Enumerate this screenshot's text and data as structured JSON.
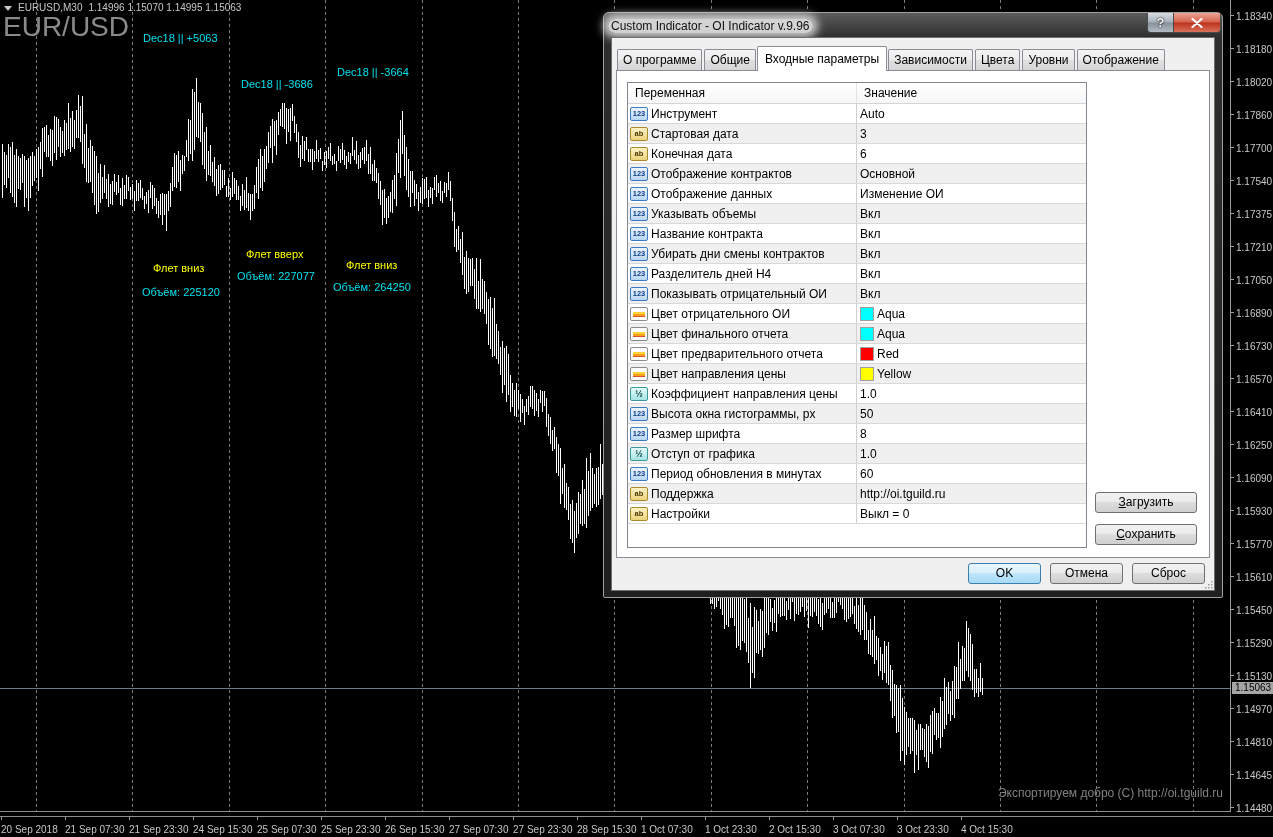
{
  "chart": {
    "title": "EURUSD,M30",
    "quotes": "1.14996 1.15070 1.14995 1.15063",
    "symbol_label": "EUR/USD",
    "labels": [
      {
        "kind": "oi",
        "text": "Dec18 || +5063"
      },
      {
        "kind": "oi",
        "text": "Dec18 || -3686"
      },
      {
        "kind": "oi",
        "text": "Dec18 || -3664"
      },
      {
        "kind": "trend",
        "text": "Флет вниз"
      },
      {
        "kind": "volume",
        "text": "Объём: 225120"
      },
      {
        "kind": "trend",
        "text": "Флет вверх"
      },
      {
        "kind": "volume",
        "text": "Объём: 227077"
      },
      {
        "kind": "trend",
        "text": "Флет вниз"
      },
      {
        "kind": "volume",
        "text": "Объём: 264250"
      }
    ],
    "footer": "Экспортируем добро (C) http://oi.tguild.ru",
    "price_axis": [
      "1.18340",
      "1.18180",
      "1.18020",
      "1.17860",
      "1.17700",
      "1.17540",
      "1.17375",
      "1.17210",
      "1.17050",
      "1.16890",
      "1.16730",
      "1.16570",
      "1.16410",
      "1.16250",
      "1.16090",
      "1.15930",
      "1.15770",
      "1.15610",
      "1.15450",
      "1.15290",
      "1.15130",
      "1.14970",
      "1.14810",
      "1.14645",
      "1.14480"
    ],
    "current_price": "1.15063",
    "time_axis": [
      "20 Sep 2018",
      "21 Sep 07:30",
      "21 Sep 23:30",
      "24 Sep 15:30",
      "25 Sep 07:30",
      "25 Sep 23:30",
      "26 Sep 15:30",
      "27 Sep 07:30",
      "27 Sep 23:30",
      "28 Sep 15:30",
      "1 Oct 07:30",
      "1 Oct 23:30",
      "2 Oct 15:30",
      "3 Oct 07:30",
      "3 Oct 23:30",
      "4 Oct 15:30"
    ]
  },
  "dialog": {
    "title": "Custom Indicator - OI Indicator v.9.96",
    "help": "?",
    "tabs": [
      {
        "label": "О программе",
        "selected": false
      },
      {
        "label": "Общие",
        "selected": false
      },
      {
        "label": "Входные параметры",
        "selected": true
      },
      {
        "label": "Зависимости",
        "selected": false
      },
      {
        "label": "Цвета",
        "selected": false
      },
      {
        "label": "Уровни",
        "selected": false
      },
      {
        "label": "Отображение",
        "selected": false
      }
    ],
    "table": {
      "columns": [
        "Переменная",
        "Значение"
      ],
      "rows": [
        {
          "kind": "int",
          "icon": "123",
          "name": "Инструмент",
          "value": "Auto"
        },
        {
          "kind": "string",
          "icon": "ab",
          "name": "Стартовая дата",
          "value": "3"
        },
        {
          "kind": "string",
          "icon": "ab",
          "name": "Конечная дата",
          "value": "6"
        },
        {
          "kind": "int",
          "icon": "123",
          "name": "Отображение контрактов",
          "value": "Основной"
        },
        {
          "kind": "int",
          "icon": "123",
          "name": "Отображение данных",
          "value": "Изменение ОИ"
        },
        {
          "kind": "int",
          "icon": "123",
          "name": "Указывать объемы",
          "value": "Вкл"
        },
        {
          "kind": "int",
          "icon": "123",
          "name": "Название контракта",
          "value": "Вкл"
        },
        {
          "kind": "int",
          "icon": "123",
          "name": "Убирать дни смены контрактов",
          "value": "Вкл"
        },
        {
          "kind": "int",
          "icon": "123",
          "name": "Разделитель дней H4",
          "value": "Вкл"
        },
        {
          "kind": "int",
          "icon": "123",
          "name": "Показывать отрицательный ОИ",
          "value": "Вкл"
        },
        {
          "kind": "color",
          "name": "Цвет отрицательного ОИ",
          "value": "Aqua",
          "color": "#00ffff"
        },
        {
          "kind": "color",
          "name": "Цвет финального отчета",
          "value": "Aqua",
          "color": "#00ffff"
        },
        {
          "kind": "color",
          "name": "Цвет предварительного отчета",
          "value": "Red",
          "color": "#ff0000"
        },
        {
          "kind": "color",
          "name": "Цвет направления цены",
          "value": "Yellow",
          "color": "#ffff00"
        },
        {
          "kind": "double",
          "icon": "½",
          "name": "Коэффициент направления цены",
          "value": "1.0"
        },
        {
          "kind": "int",
          "icon": "123",
          "name": "Высота окна гистограммы, px",
          "value": "50"
        },
        {
          "kind": "int",
          "icon": "123",
          "name": "Размер шрифта",
          "value": "8"
        },
        {
          "kind": "double",
          "icon": "½",
          "name": "Отступ от графика",
          "value": "1.0"
        },
        {
          "kind": "int",
          "icon": "123",
          "name": "Период обновления в минутах",
          "value": "60"
        },
        {
          "kind": "string",
          "icon": "ab",
          "name": "Поддержка",
          "value": "http://oi.tguild.ru"
        },
        {
          "kind": "string",
          "icon": "ab",
          "name": "Настройки",
          "value": "Выкл = 0"
        }
      ]
    },
    "side_buttons": [
      "Загрузить",
      "Сохранить"
    ],
    "buttons": [
      {
        "label": "OK",
        "default": true
      },
      {
        "label": "Отмена",
        "default": false
      },
      {
        "label": "Сброс",
        "default": false
      }
    ]
  }
}
